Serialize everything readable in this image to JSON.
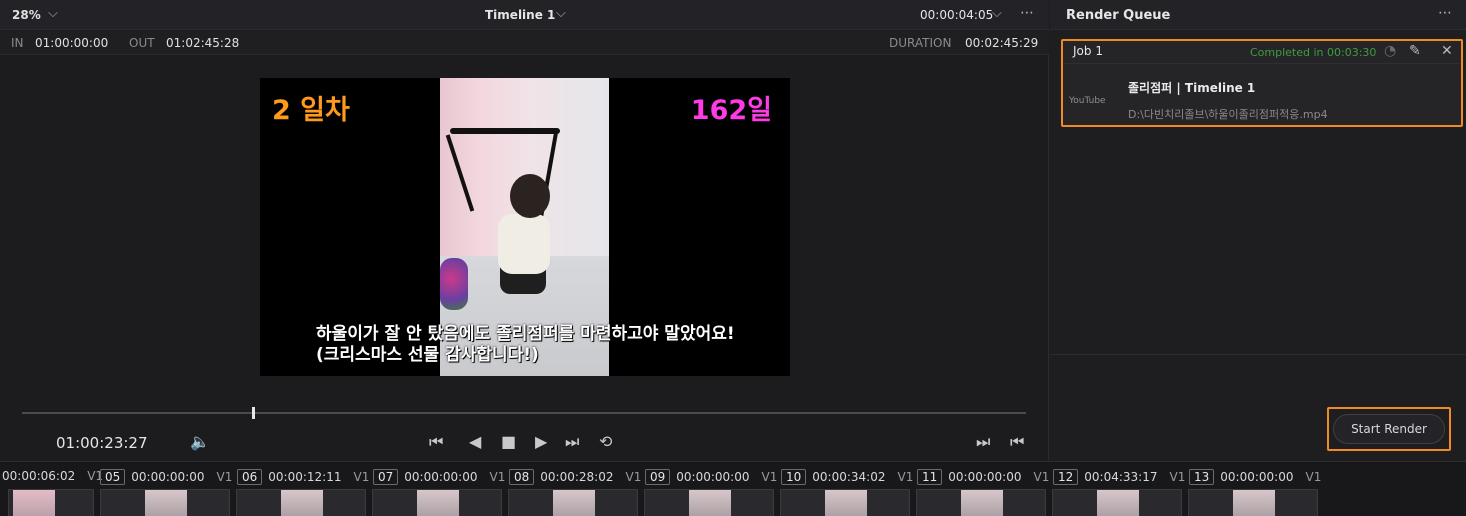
{
  "viewer": {
    "zoom": "28%",
    "timeline_title": "Timeline 1",
    "timecode_top": "00:00:04:05",
    "in_label": "IN",
    "in_value": "01:00:00:00",
    "out_label": "OUT",
    "out_value": "01:02:45:28",
    "duration_label": "DURATION",
    "duration_value": "00:02:45:29",
    "overlay_left": "2 일차",
    "overlay_right": "162일",
    "subtitle_line1": "하울이가 잘 안 탔음에도 졸리점퍼를 마련하고야 말았어요!",
    "subtitle_line2": "(크리스마스 선물 감사합니다!)",
    "playhead_timecode": "01:00:23:27",
    "playhead_progress": 0.23
  },
  "render_queue": {
    "title": "Render Queue",
    "job": {
      "name": "Job 1",
      "status": "Completed in 00:03:30",
      "file_title": "졸리점퍼 | Timeline 1",
      "path": "D:\\다빈치리졸브\\하울이졸리점퍼적응.mp4",
      "platform_logo": "YouTube"
    },
    "start_button": "Start Render"
  },
  "clips": [
    {
      "num": "",
      "tc": "00:00:06:02",
      "track": "V1"
    },
    {
      "num": "05",
      "tc": "00:00:00:00",
      "track": "V1"
    },
    {
      "num": "06",
      "tc": "00:00:12:11",
      "track": "V1"
    },
    {
      "num": "07",
      "tc": "00:00:00:00",
      "track": "V1"
    },
    {
      "num": "08",
      "tc": "00:00:28:02",
      "track": "V1"
    },
    {
      "num": "09",
      "tc": "00:00:00:00",
      "track": "V1"
    },
    {
      "num": "10",
      "tc": "00:00:34:02",
      "track": "V1"
    },
    {
      "num": "11",
      "tc": "00:00:00:00",
      "track": "V1"
    },
    {
      "num": "12",
      "tc": "00:04:33:17",
      "track": "V1"
    },
    {
      "num": "13",
      "tc": "00:00:00:00",
      "track": "V1"
    }
  ],
  "icons": {
    "more": "⋯",
    "chevron": "⌵",
    "volume": "🔈",
    "go_start": "⏮",
    "prev": "◀",
    "stop": "■",
    "play": "▶",
    "go_end": "⏭",
    "loop": "⟲",
    "edit": "✎",
    "close": "✕",
    "wifi": "◔"
  }
}
